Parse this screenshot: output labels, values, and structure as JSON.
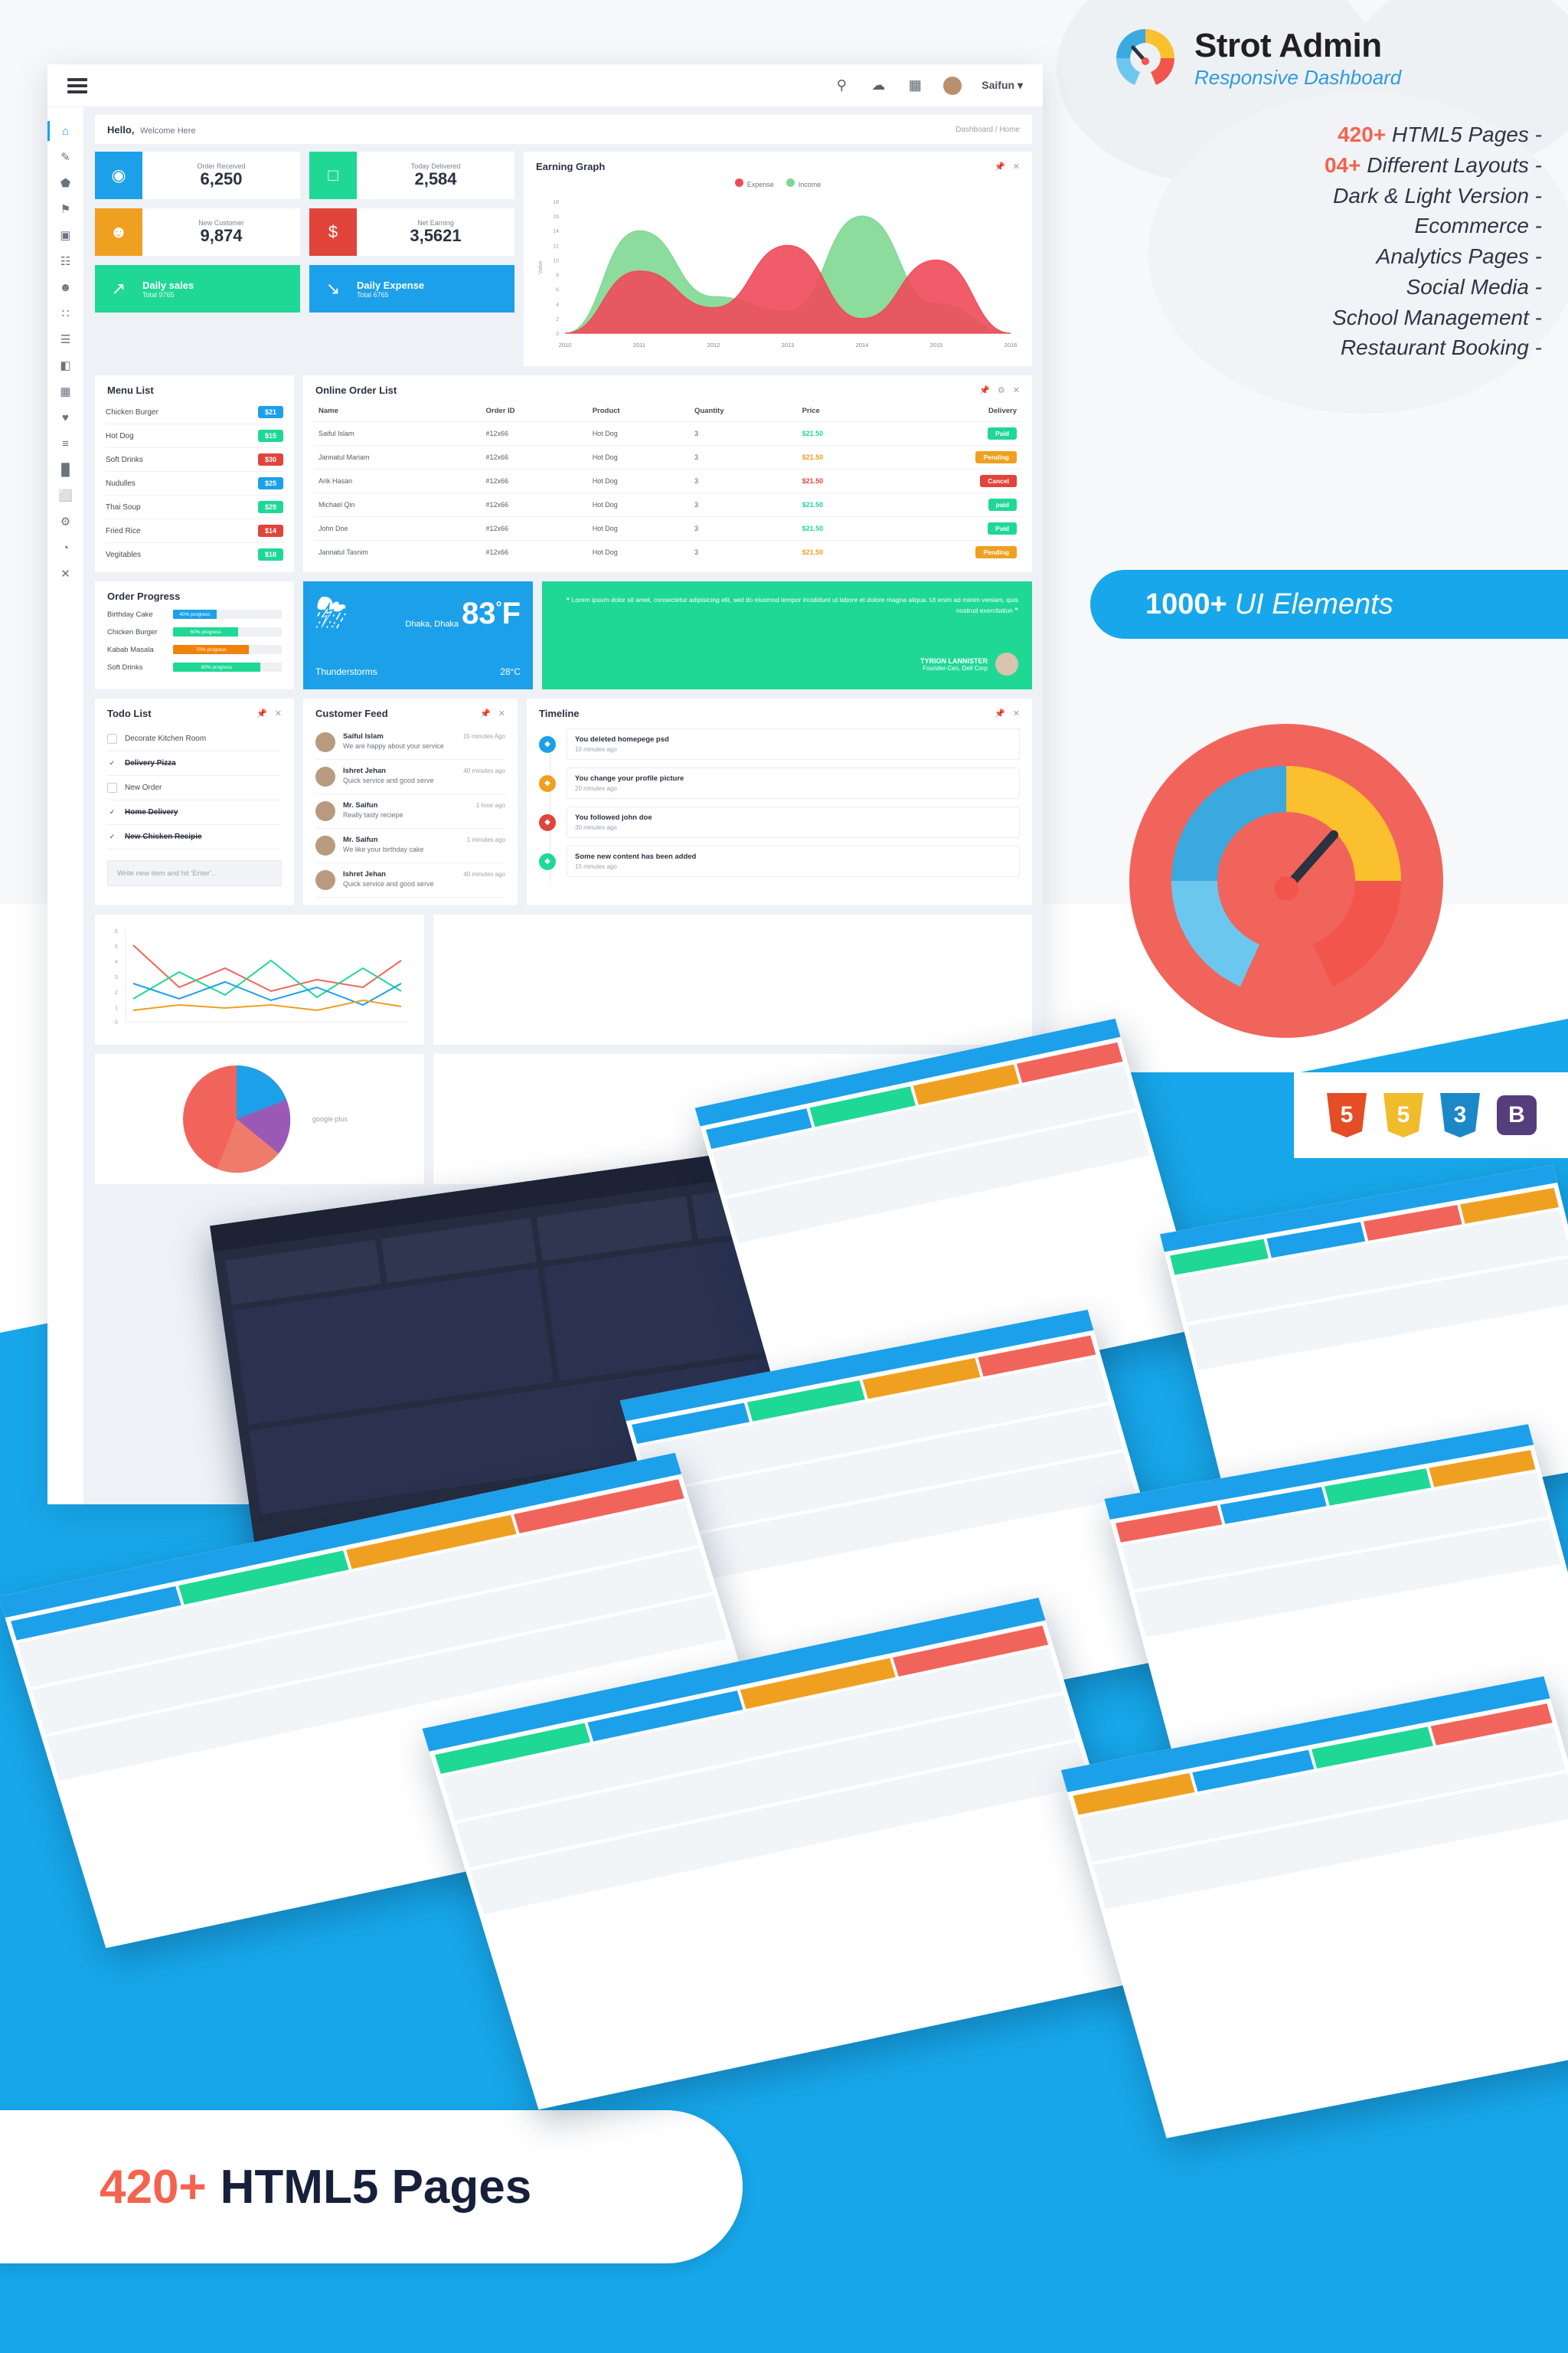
{
  "promo": {
    "brand_title": "Strot Admin",
    "brand_subtitle": "Responsive Dashboard",
    "features": [
      {
        "num": "420+",
        "text": "HTML5 Pages -"
      },
      {
        "num": "04+",
        "text": "Different Layouts -"
      },
      {
        "num": "",
        "text": "Dark & Light Version -"
      },
      {
        "num": "",
        "text": "Ecommerce -"
      },
      {
        "num": "",
        "text": "Analytics Pages -"
      },
      {
        "num": "",
        "text": "Social Media -"
      },
      {
        "num": "",
        "text": "School Management -"
      },
      {
        "num": "",
        "text": "Restaurant Booking -"
      }
    ],
    "ui_elements_count": "1000+",
    "ui_elements_label": "UI Elements",
    "tech_badges": [
      {
        "name": "html5-badge",
        "label": "5",
        "color": "#e44d26"
      },
      {
        "name": "javascript-badge",
        "label": "5",
        "color": "#f0bc2c"
      },
      {
        "name": "css3-badge",
        "label": "3",
        "color": "#1c88c7"
      },
      {
        "name": "bootstrap-badge",
        "label": "B",
        "color": "#563d7c"
      }
    ],
    "accent_orange": "#f4634f",
    "accent_blue": "#17a7ea"
  },
  "bottom_banner": {
    "num": "420+",
    "text": "HTML5 Pages"
  },
  "dashboard": {
    "topbar": {
      "menu_icon": "hamburger-icon",
      "icons": [
        "search-icon",
        "bell-icon",
        "grid-icon"
      ],
      "user_name": "Saifun",
      "caret": "▾"
    },
    "sidebar": {
      "items": [
        {
          "name": "home",
          "glyph": "⌂",
          "active": true
        },
        {
          "name": "edit",
          "glyph": "✎",
          "active": false
        },
        {
          "name": "badge",
          "glyph": "⬟",
          "active": false
        },
        {
          "name": "flag",
          "glyph": "⚑",
          "active": false
        },
        {
          "name": "inbox",
          "glyph": "▣",
          "active": false
        },
        {
          "name": "film",
          "glyph": "☷",
          "active": false
        },
        {
          "name": "user",
          "glyph": "☻",
          "active": false
        },
        {
          "name": "apps",
          "glyph": "∷",
          "active": false
        },
        {
          "name": "calendar",
          "glyph": "☰",
          "active": false
        },
        {
          "name": "image",
          "glyph": "◧",
          "active": false
        },
        {
          "name": "table",
          "glyph": "▦",
          "active": false
        },
        {
          "name": "heart",
          "glyph": "♥",
          "active": false
        },
        {
          "name": "layers",
          "glyph": "≡",
          "active": false
        },
        {
          "name": "chart",
          "glyph": "█",
          "active": false
        },
        {
          "name": "cube",
          "glyph": "⬜",
          "active": false
        },
        {
          "name": "settings",
          "glyph": "⚙",
          "active": false
        },
        {
          "name": "pie",
          "glyph": "◔",
          "active": false
        },
        {
          "name": "close",
          "glyph": "✕",
          "active": false
        }
      ]
    },
    "welcome": {
      "hello": "Hello,",
      "sub": "Welcome Here",
      "breadcrumb": "Dashboard / Home"
    },
    "stats": [
      {
        "label": "Order Received",
        "value": "6,250",
        "color": "#1ca0ea",
        "icon": "eye-icon",
        "glyph": "◉"
      },
      {
        "label": "Today Delivered",
        "value": "2,584",
        "color": "#1fd896",
        "icon": "bag-icon",
        "glyph": "□"
      },
      {
        "label": "New Customer",
        "value": "9,874",
        "color": "#f0a020",
        "icon": "user-icon",
        "glyph": "☻"
      },
      {
        "label": "Net Earning",
        "value": "3,5621",
        "color": "#e1443b",
        "icon": "dollar-icon",
        "glyph": "$"
      }
    ],
    "wide_cards": [
      {
        "title": "Daily sales",
        "sub": "Total 9765",
        "color": "#1fd896",
        "icon": "trend-up-icon",
        "glyph": "↗"
      },
      {
        "title": "Daily Expense",
        "sub": "Total 6765",
        "color": "#1ca0ea",
        "icon": "trend-down-icon",
        "glyph": "↘"
      }
    ],
    "earning_panel": {
      "title": "Earning Graph",
      "tools": [
        "pin-icon",
        "close-icon"
      ]
    },
    "menu_list": {
      "title": "Menu List",
      "items": [
        {
          "name": "Chicken Burger",
          "price": "$21",
          "color": "#1ca0ea"
        },
        {
          "name": "Hot Dog",
          "price": "$15",
          "color": "#1fd896"
        },
        {
          "name": "Soft Drinks",
          "price": "$30",
          "color": "#e1443b"
        },
        {
          "name": "Nudulles",
          "price": "$25",
          "color": "#1ca0ea"
        },
        {
          "name": "Thai Soup",
          "price": "$29",
          "color": "#1fd896"
        },
        {
          "name": "Fried Rice",
          "price": "$14",
          "color": "#e1443b"
        },
        {
          "name": "Vegitables",
          "price": "$18",
          "color": "#1fd896"
        }
      ]
    },
    "order_list": {
      "title": "Online Order List",
      "tools": [
        "pin-icon",
        "gear-icon",
        "close-icon"
      ],
      "columns": [
        "Name",
        "Order ID",
        "Product",
        "Quantity",
        "Price",
        "Delivery"
      ],
      "rows": [
        {
          "name": "Saiful Islam",
          "order_id": "#12x66",
          "product": "Hot Dog",
          "qty": "3",
          "price": "$21.50",
          "price_color": "#1fd896",
          "status": "Paid",
          "status_color": "#1fd896"
        },
        {
          "name": "Jannatul Mariam",
          "order_id": "#12x66",
          "product": "Hot Dog",
          "qty": "3",
          "price": "$21.50",
          "price_color": "#f0a020",
          "status": "Pending",
          "status_color": "#f0a020"
        },
        {
          "name": "Arik Hasan",
          "order_id": "#12x66",
          "product": "Hot Dog",
          "qty": "3",
          "price": "$21.50",
          "price_color": "#e1443b",
          "status": "Cancel",
          "status_color": "#e1443b"
        },
        {
          "name": "Michael Qin",
          "order_id": "#12x66",
          "product": "Hot Dog",
          "qty": "3",
          "price": "$21.50",
          "price_color": "#1fd896",
          "status": "paid",
          "status_color": "#1fd896"
        },
        {
          "name": "John Doe",
          "order_id": "#12x66",
          "product": "Hot Dog",
          "qty": "3",
          "price": "$21.50",
          "price_color": "#1fd896",
          "status": "Paid",
          "status_color": "#1fd896"
        },
        {
          "name": "Jannatul Tasnim",
          "order_id": "#12x66",
          "product": "Hot Dog",
          "qty": "3",
          "price": "$21.50",
          "price_color": "#f0a020",
          "status": "Pending",
          "status_color": "#f0a020"
        }
      ]
    },
    "order_progress": {
      "title": "Order Progress",
      "items": [
        {
          "name": "Birthday Cake",
          "label": "40% progress",
          "percent": 40,
          "color": "#1ca0ea"
        },
        {
          "name": "Chicken Burger",
          "label": "60% progress",
          "percent": 60,
          "color": "#1fd896"
        },
        {
          "name": "Kabab Masala",
          "label": "70% progress",
          "percent": 70,
          "color": "#f0820a"
        },
        {
          "name": "Soft Drinks",
          "label": "80% progress",
          "percent": 80,
          "color": "#1fd896"
        }
      ]
    },
    "weather": {
      "icon": "thunderstorm-icon",
      "city": "Dhaka, Dhaka",
      "temp_f": "83",
      "degree": "°",
      "unit": "F",
      "condition": "Thunderstorms",
      "temp_c": "28°C"
    },
    "testimonial": {
      "quote_open": "❝",
      "text": "Lorem ipsum dolor sit amet, consectetur adipisicing elit, sed do eiusmod tempor incididunt ut labore et dolore magna aliqua. Ut enim ad minim veniam, quis nostrud exercitation",
      "quote_close": "❞",
      "name": "TYRION LANNISTER",
      "role": "Founder-Ceo, Dell Corp"
    },
    "todo": {
      "title": "Todo List",
      "tools": [
        "pin-icon",
        "close-icon"
      ],
      "items": [
        {
          "text": "Decorate Kitchen Room",
          "done": false
        },
        {
          "text": "Delivery Pizza",
          "done": true
        },
        {
          "text": "New Order",
          "done": false
        },
        {
          "text": "Home Delivery",
          "done": true
        },
        {
          "text": "New Chicken Recipie",
          "done": true
        }
      ],
      "input_placeholder": "Write new item and hit 'Enter'.."
    },
    "customer_feed": {
      "title": "Customer Feed",
      "tools": [
        "pin-icon",
        "close-icon"
      ],
      "items": [
        {
          "name": "Saiful Islam",
          "msg": "We are happy about your service",
          "time": "15 minutes Ago"
        },
        {
          "name": "Ishret Jehan",
          "msg": "Quick service and good serve",
          "time": "40 minutes ago"
        },
        {
          "name": "Mr. Saifun",
          "msg": "Really tasty reciepe",
          "time": "1 hour ago"
        },
        {
          "name": "Mr. Saifun",
          "msg": "We like your birthday cake",
          "time": "1 minutes ago"
        },
        {
          "name": "Ishret Jehan",
          "msg": "Quick service and good serve",
          "time": "40 minutes ago"
        }
      ]
    },
    "timeline": {
      "title": "Timeline",
      "tools": [
        "pin-icon",
        "close-icon"
      ],
      "items": [
        {
          "title": "You deleted homepege psd",
          "time": "10 minutes ago",
          "color": "#1ca0ea",
          "glyph": "◆"
        },
        {
          "title": "You change your profile picture",
          "time": "20 minutes ago",
          "color": "#f0a020",
          "glyph": "◆"
        },
        {
          "title": "You followed john doe",
          "time": "30 minutes ago",
          "color": "#e1443b",
          "glyph": "◆"
        },
        {
          "title": "Some new content has been added",
          "time": "15 minutes ago",
          "color": "#1fd896",
          "glyph": "◆"
        }
      ]
    },
    "bottom_charts": {
      "pie_label": "google plus"
    }
  },
  "chart_data": {
    "type": "area",
    "title": "Earning Graph",
    "xlabel": "",
    "ylabel": "Value",
    "x": [
      "2010",
      "2011",
      "2012",
      "2013",
      "2014",
      "2015",
      "2016"
    ],
    "ylim": [
      0,
      18
    ],
    "yticks": [
      0,
      2,
      4,
      6,
      8,
      10,
      12,
      14,
      16,
      18
    ],
    "grid": false,
    "legend_position": "top-center",
    "series": [
      {
        "name": "Income",
        "color": "#7fd892",
        "values": [
          0,
          14,
          5,
          3,
          16,
          4,
          0
        ]
      },
      {
        "name": "Expense",
        "color": "#ef4a5a",
        "values": [
          0,
          8.5,
          3.5,
          12,
          2,
          10,
          0
        ]
      }
    ]
  }
}
